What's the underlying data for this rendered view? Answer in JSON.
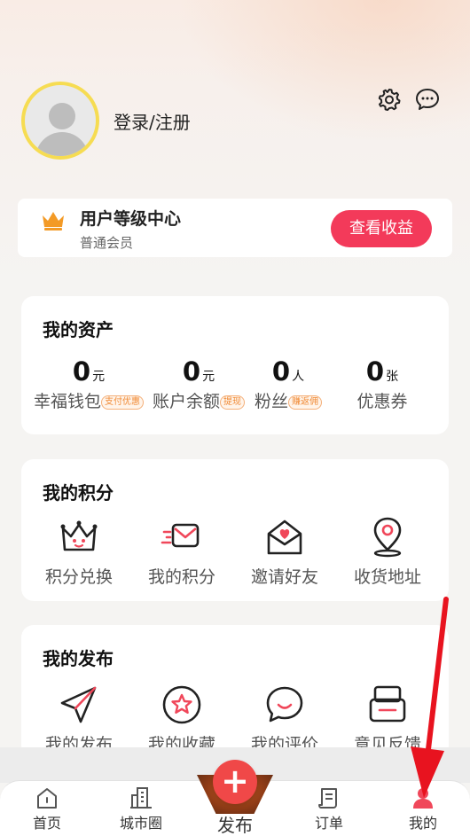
{
  "header": {
    "login_label": "登录/注册",
    "icons": [
      "settings-icon",
      "message-icon"
    ]
  },
  "level_card": {
    "title": "用户等级中心",
    "subtitle": "普通会员",
    "button_label": "查看收益",
    "icon": "crown-icon"
  },
  "assets": {
    "title": "我的资产",
    "items": [
      {
        "value": "0",
        "unit": "元",
        "label": "幸福钱包",
        "tag": "支付优惠"
      },
      {
        "value": "0",
        "unit": "元",
        "label": "账户余额",
        "tag": "提现"
      },
      {
        "value": "0",
        "unit": "人",
        "label": "粉丝",
        "tag": "赚返佣"
      },
      {
        "value": "0",
        "unit": "张",
        "label": "优惠券",
        "tag": ""
      }
    ]
  },
  "points": {
    "title": "我的积分",
    "items": [
      {
        "label": "积分兑换",
        "icon": "points-exchange-icon"
      },
      {
        "label": "我的积分",
        "icon": "my-points-icon"
      },
      {
        "label": "邀请好友",
        "icon": "invite-friends-icon"
      },
      {
        "label": "收货地址",
        "icon": "location-pin-icon"
      }
    ]
  },
  "publish": {
    "title": "我的发布",
    "items": [
      {
        "label": "我的发布",
        "icon": "send-icon"
      },
      {
        "label": "我的收藏",
        "icon": "star-icon"
      },
      {
        "label": "我的评价",
        "icon": "comment-icon"
      },
      {
        "label": "意见反馈",
        "icon": "feedback-icon"
      }
    ]
  },
  "tabbar": {
    "tabs": [
      {
        "label": "首页",
        "icon": "home-icon"
      },
      {
        "label": "城市圈",
        "icon": "city-icon"
      },
      {
        "label": "发布",
        "icon": "plus-icon"
      },
      {
        "label": "订单",
        "icon": "order-icon"
      },
      {
        "label": "我的",
        "icon": "profile-icon"
      }
    ],
    "active_index": 4
  },
  "colors": {
    "accent": "#f33a5a",
    "icon_pink": "#f0475a",
    "avatar_ring": "#f6dc52",
    "tag_orange": "#f08a35"
  }
}
